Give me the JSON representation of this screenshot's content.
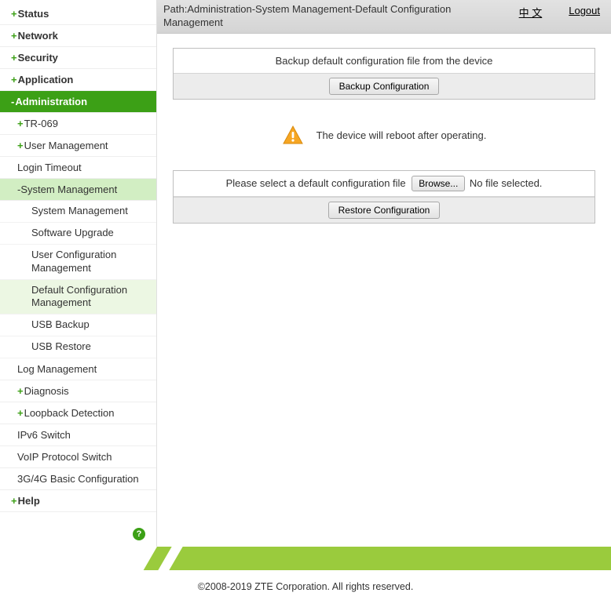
{
  "sidebar": {
    "status": "Status",
    "network": "Network",
    "security": "Security",
    "application": "Application",
    "administration": "Administration",
    "admin": {
      "tr069": "TR-069",
      "user_mgmt": "User Management",
      "login_timeout": "Login Timeout",
      "sys_mgmt": "System Management",
      "sys_mgmt_sub": {
        "system_management": "System Management",
        "software_upgrade": "Software Upgrade",
        "user_cfg_mgmt": "User Configuration Management",
        "default_cfg_mgmt": "Default Configuration Management",
        "usb_backup": "USB Backup",
        "usb_restore": "USB Restore"
      },
      "log_mgmt": "Log Management",
      "diagnosis": "Diagnosis",
      "loopback": "Loopback Detection",
      "ipv6_switch": "IPv6 Switch",
      "voip_switch": "VoIP Protocol Switch",
      "basic_3g4g": "3G/4G Basic Configuration"
    },
    "help": "Help"
  },
  "topbar": {
    "path": "Path:Administration-System Management-Default Configuration Management",
    "lang": "中 文",
    "logout": "Logout"
  },
  "backup": {
    "title": "Backup default configuration file from the device",
    "button": "Backup Configuration"
  },
  "warning": "The device will reboot after operating.",
  "restore": {
    "prompt": "Please select a default configuration file",
    "browse": "Browse...",
    "nofile": "No file selected.",
    "button": "Restore Configuration"
  },
  "footer": "©2008-2019 ZTE Corporation. All rights reserved."
}
